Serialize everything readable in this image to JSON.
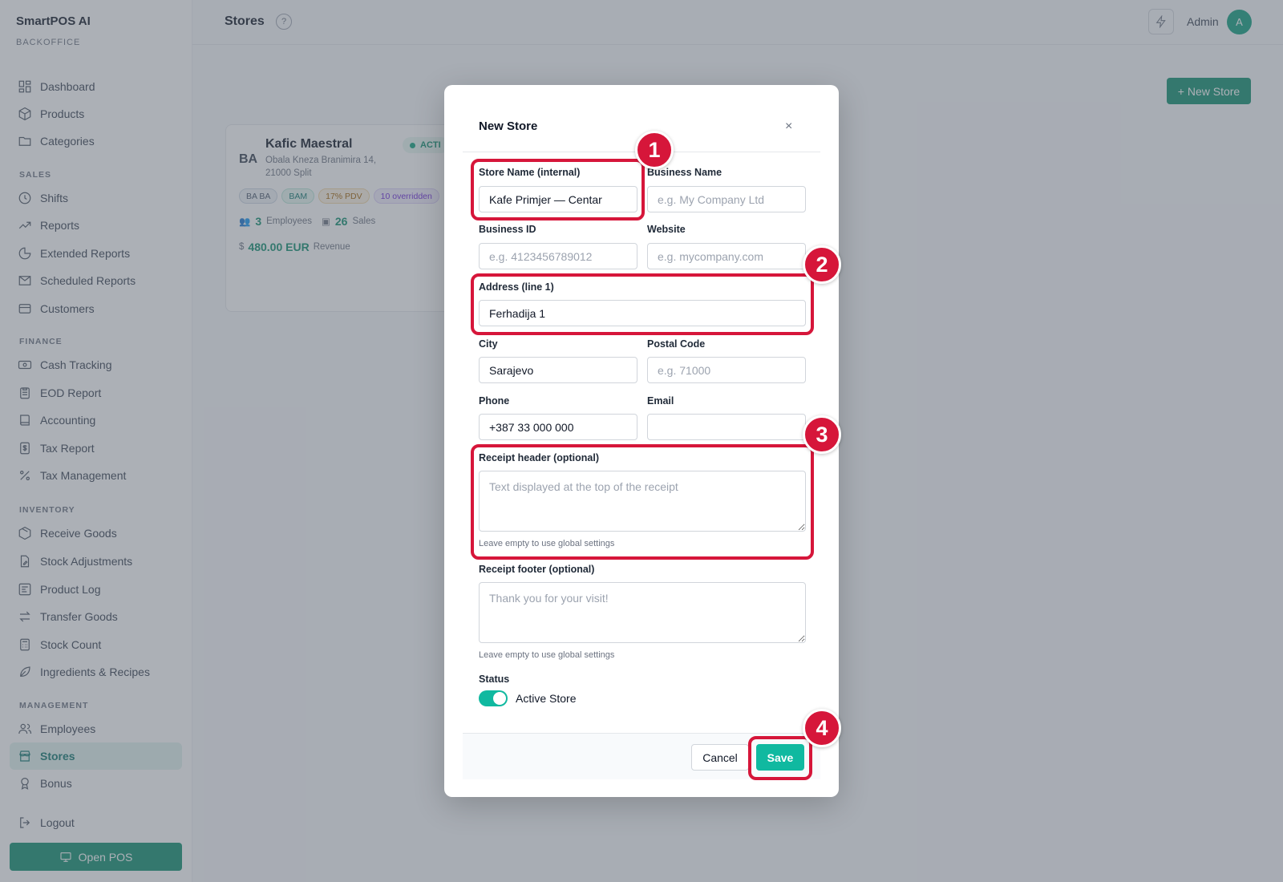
{
  "app": {
    "name": "SmartPOS AI",
    "subtitle": "BACKOFFICE"
  },
  "sidebar": {
    "items": [
      {
        "label": "Dashboard",
        "icon": "dashboard-icon"
      },
      {
        "label": "Products",
        "icon": "box-icon"
      },
      {
        "label": "Categories",
        "icon": "folder-icon"
      },
      {
        "label": "Shifts",
        "icon": "clock-icon"
      },
      {
        "label": "Reports",
        "icon": "trend-icon"
      },
      {
        "label": "Extended Reports",
        "icon": "pie-chart-icon"
      },
      {
        "label": "Scheduled Reports",
        "icon": "mail-icon"
      },
      {
        "label": "Customers",
        "icon": "card-icon"
      },
      {
        "label": "Cash Tracking",
        "icon": "cash-icon"
      },
      {
        "label": "EOD Report",
        "icon": "clipboard-icon"
      },
      {
        "label": "Accounting",
        "icon": "book-icon"
      },
      {
        "label": "Tax Report",
        "icon": "dollar-doc-icon"
      },
      {
        "label": "Tax Management",
        "icon": "percent-icon"
      },
      {
        "label": "Receive Goods",
        "icon": "package-icon"
      },
      {
        "label": "Stock Adjustments",
        "icon": "doc-edit-icon"
      },
      {
        "label": "Product Log",
        "icon": "list-icon"
      },
      {
        "label": "Transfer Goods",
        "icon": "transfer-icon"
      },
      {
        "label": "Stock Count",
        "icon": "calculator-icon"
      },
      {
        "label": "Ingredients & Recipes",
        "icon": "leaf-icon"
      },
      {
        "label": "Employees",
        "icon": "users-icon"
      },
      {
        "label": "Stores",
        "icon": "store-icon"
      },
      {
        "label": "Bonus",
        "icon": "award-icon"
      }
    ],
    "sections": [
      "SALES",
      "FINANCE",
      "INVENTORY",
      "MANAGEMENT"
    ],
    "logout": "Logout",
    "open_pos": "Open POS",
    "active": "Stores"
  },
  "header": {
    "title": "Stores",
    "help": "?",
    "user": "Admin",
    "avatar_initial": "A"
  },
  "actions": {
    "new_store": "+ New Store"
  },
  "store_card": {
    "flag": "BA",
    "name": "Kafic Maestral",
    "address_line1": "Obala Kneza Branimira 14,",
    "address_line2": "21000 Split",
    "status": "ACTI",
    "chips": [
      "BA BA",
      "BAM",
      "17% PDV",
      "10 overridden"
    ],
    "employees_count": "3",
    "employees_label": "Employees",
    "sales_count": "26",
    "sales_label": "Sales",
    "revenue_value": "480.00 EUR",
    "revenue_label": "Revenue"
  },
  "modal": {
    "title": "New Store",
    "close": "×",
    "fields": {
      "store_name": {
        "label": "Store Name (internal)",
        "value": "Kafe Primjer — Centar",
        "placeholder": ""
      },
      "business_name": {
        "label": "Business Name",
        "value": "",
        "placeholder": "e.g. My Company Ltd"
      },
      "business_id": {
        "label": "Business ID",
        "value": "",
        "placeholder": "e.g. 4123456789012"
      },
      "website": {
        "label": "Website",
        "value": "",
        "placeholder": "e.g. mycompany.com"
      },
      "address": {
        "label": "Address (line 1)",
        "value": "Ferhadija 1",
        "placeholder": ""
      },
      "city": {
        "label": "City",
        "value": "Sarajevo",
        "placeholder": ""
      },
      "postal_code": {
        "label": "Postal Code",
        "value": "",
        "placeholder": "e.g. 71000"
      },
      "phone": {
        "label": "Phone",
        "value": "+387 33 000 000",
        "placeholder": ""
      },
      "email": {
        "label": "Email",
        "value": "",
        "placeholder": ""
      },
      "receipt_header": {
        "label": "Receipt header (optional)",
        "value": "",
        "placeholder": "Text displayed at the top of the receipt",
        "hint": "Leave empty to use global settings"
      },
      "receipt_footer": {
        "label": "Receipt footer (optional)",
        "value": "",
        "placeholder": "Thank you for your visit!",
        "hint": "Leave empty to use global settings"
      }
    },
    "status": {
      "label": "Status",
      "toggle_label": "Active Store",
      "enabled": true
    },
    "cancel": "Cancel",
    "save": "Save"
  },
  "annotations": [
    "1",
    "2",
    "3",
    "4"
  ],
  "colors": {
    "accent": "#0f8f6f",
    "toggle": "#10b9a0",
    "highlight": "#d6163a"
  }
}
